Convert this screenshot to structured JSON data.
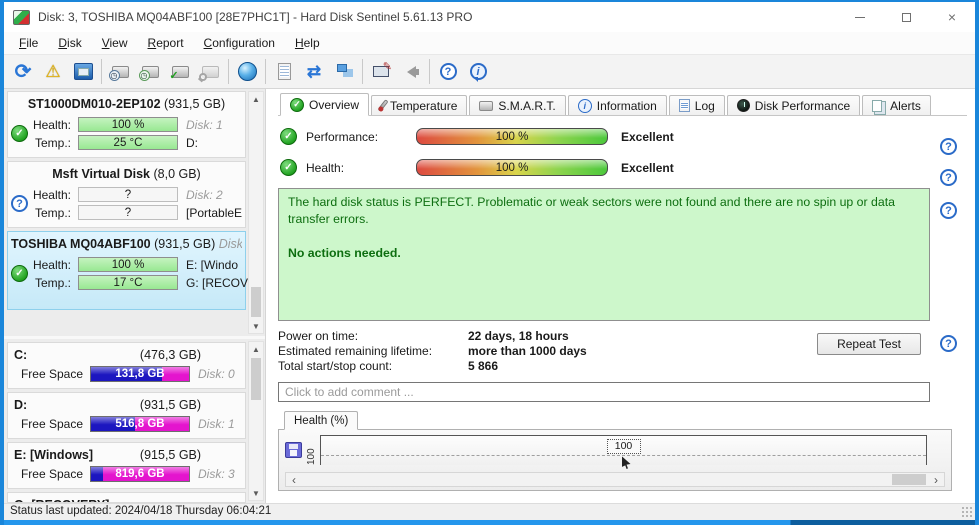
{
  "window": {
    "title": "Disk: 3, TOSHIBA MQ04ABF100 [28E7PHC1T]  -  Hard Disk Sentinel 5.61.13 PRO"
  },
  "icons": {
    "close": "×",
    "scroll_up": "▲",
    "scroll_down": "▼",
    "scroll_left": "‹",
    "scroll_right": "›",
    "help": "?",
    "info": "i",
    "check": "✓",
    "question": "?",
    "refresh": "⟳",
    "warning": "⚠",
    "sync": "⇄",
    "pen": "✎"
  },
  "menu": {
    "items": [
      "File",
      "Disk",
      "View",
      "Report",
      "Configuration",
      "Help"
    ]
  },
  "toolbar": {
    "icon_names": [
      "refresh",
      "status-alert",
      "disk-monitor",
      "disk-test-clock-1",
      "disk-test-clock-2",
      "disk-test-ok",
      "disk-surface-test",
      "network-globe",
      "report",
      "sync",
      "network-computers",
      "remote-monitor",
      "sound",
      "help",
      "information"
    ]
  },
  "sidebar": {
    "labels": {
      "health": "Health:",
      "temp": "Temp.:",
      "free_space": "Free Space"
    },
    "disks": [
      {
        "name": "ST1000DM010-2EP102",
        "size": "(931,5 GB)",
        "health": "100 %",
        "temp": "25 °C",
        "disk": "Disk: 1",
        "drive": "D:"
      },
      {
        "vendor": "Msft",
        "name": "Virtual Disk",
        "size": "(8,0 GB)",
        "health": "?",
        "temp": "?",
        "disk": "Disk: 2",
        "drive": "[PortableE"
      },
      {
        "name": "TOSHIBA MQ04ABF100",
        "size": "(931,5 GB)",
        "disk": "Disk:",
        "health": "100 %",
        "temp": "17 °C",
        "drive1": "E: [Windo",
        "drive2": "G: [RECOV"
      }
    ],
    "partitions": [
      {
        "name": "C:",
        "size": "(476,3 GB)",
        "free": "131,8 GB",
        "disk": "Disk: 0"
      },
      {
        "name": "D:",
        "size": "(931,5 GB)",
        "free": "516,8 GB",
        "disk": "Disk: 1"
      },
      {
        "name": "E: [Windows]",
        "size": "(915,5 GB)",
        "free": "819,6 GB",
        "disk": "Disk: 3"
      },
      {
        "name": "G: [RECOVERY]",
        "size": "",
        "free": "",
        "disk": ""
      }
    ]
  },
  "tabs": {
    "items": [
      "Overview",
      "Temperature",
      "S.M.A.R.T.",
      "Information",
      "Log",
      "Disk Performance",
      "Alerts"
    ],
    "active": "Overview"
  },
  "overview": {
    "performance_label": "Performance:",
    "performance_value": "100 %",
    "performance_rating": "Excellent",
    "health_label": "Health:",
    "health_value": "100 %",
    "health_rating": "Excellent",
    "status_message": "The hard disk status is PERFECT. Problematic or weak sectors were not found and there are no spin up or data transfer errors.",
    "status_action": "No actions needed.",
    "stats": [
      {
        "label": "Power on time:",
        "value": "22 days, 18 hours"
      },
      {
        "label": "Estimated remaining lifetime:",
        "value": "more than 1000 days"
      },
      {
        "label": "Total start/stop count:",
        "value": "5 866"
      }
    ],
    "repeat_test_label": "Repeat Test",
    "comment_placeholder": "Click to add comment ...",
    "graph_tab": "Health (%)"
  },
  "chart_data": {
    "type": "line",
    "title": "Health (%)",
    "ytick_label": "100",
    "point_label": "100",
    "series": [
      {
        "name": "Health (%)",
        "values": [
          100
        ],
        "note": "flat dashed line at 100 across visible history"
      }
    ],
    "ylim": [
      0,
      100
    ],
    "legend_position": "none"
  },
  "statusbar": {
    "text": "Status last updated: 2024/04/18 Thursday 06:04:21"
  }
}
